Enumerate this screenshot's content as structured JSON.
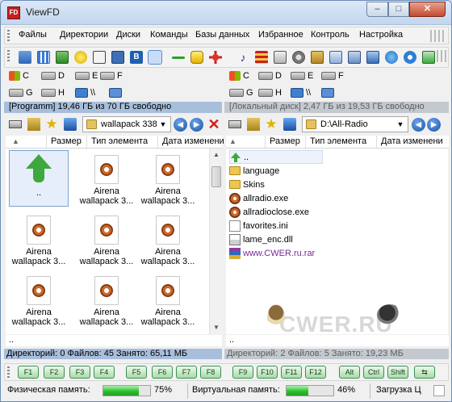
{
  "window": {
    "title": "ViewFD",
    "app_icon": "FD"
  },
  "menu": [
    "Файлы",
    "Директории",
    "Диски",
    "Команды",
    "Базы данных",
    "Избранное",
    "Контроль",
    "Настройка"
  ],
  "drives": {
    "row1": [
      "C",
      "D",
      "E",
      "F"
    ],
    "row2": [
      "G",
      "H",
      "\\\\"
    ]
  },
  "left_panel": {
    "info": "[Programm] 19,46 ГБ из 70 ГБ свободно",
    "path": "wallapack 338",
    "columns": [
      "Размер",
      "Тип элемента",
      "Дата изменени"
    ],
    "up_label": "..",
    "tiles": [
      "Airena wallapack 3...",
      "Airena wallapack 3...",
      "Airena wallapack 3...",
      "Airena wallapack 3...",
      "Airena wallapack 3...",
      "Airena wallapack 3...",
      "Airena wallapack 3...",
      "Airena wallapack 3..."
    ],
    "command_line": "..",
    "status": "Директорий: 0  Файлов: 45  Занято: 65,11 МБ"
  },
  "right_panel": {
    "info": "[Локальный диск] 2,47 ГБ из 19,53 ГБ свободно",
    "path": "D:\\All-Radio",
    "columns": [
      "Размер",
      "Тип элемента",
      "Дата изменени"
    ],
    "files": [
      "..",
      "language",
      "Skins",
      "allradio.exe",
      "allradioclose.exe",
      "favorites.ini",
      "lame_enc.dll",
      "www.CWER.ru.rar"
    ],
    "watermark": "CWER.RU",
    "command_line": "..",
    "status": "Директорий: 2  Файлов: 5  Занято: 19,23 МБ"
  },
  "fkeys": [
    "F1",
    "F2",
    "F3",
    "F4",
    "F5",
    "F6",
    "F7",
    "F8",
    "F9",
    "F10",
    "F11",
    "F12",
    "Alt",
    "Ctrl",
    "Shift"
  ],
  "bottom": {
    "physical_label": "Физическая память:",
    "physical_pct": "75%",
    "physical_value": 0.75,
    "virtual_label": "Виртуальная память:",
    "virtual_pct": "46%",
    "virtual_value": 0.46,
    "load_label": "Загрузка Ц"
  }
}
